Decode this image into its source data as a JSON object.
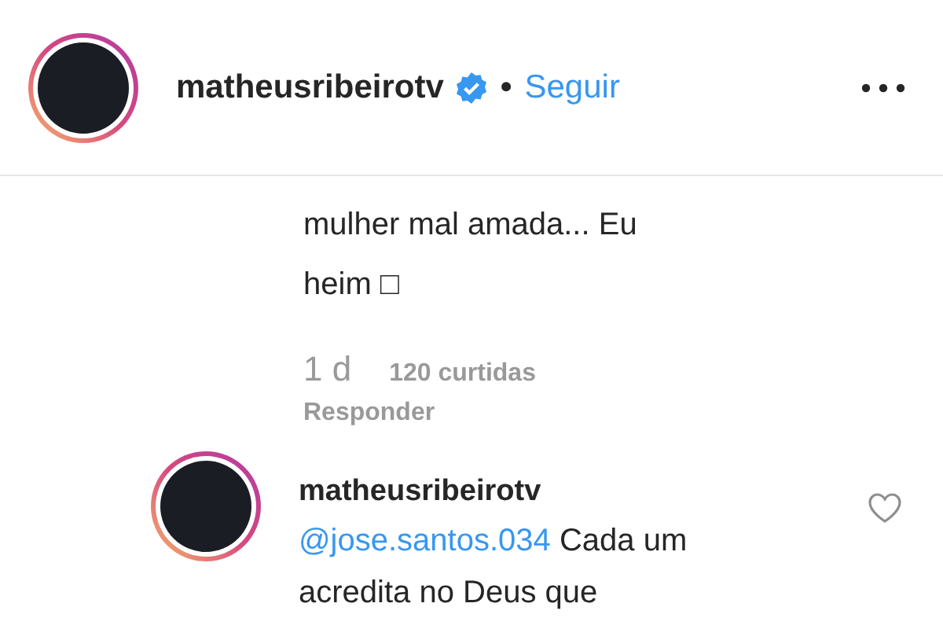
{
  "header": {
    "username": "matheusribeirotv",
    "verified": true,
    "separator": "•",
    "follow_label": "Seguir"
  },
  "comments": [
    {
      "text": "mulher mal amada... Eu heim □",
      "time": "1 d",
      "likes": "120 curtidas",
      "reply_label": "Responder"
    },
    {
      "username": "matheusribeirotv",
      "mention": "@jose.santos.034",
      "text": "Cada um acredita no Deus que",
      "liked": false
    }
  ]
}
